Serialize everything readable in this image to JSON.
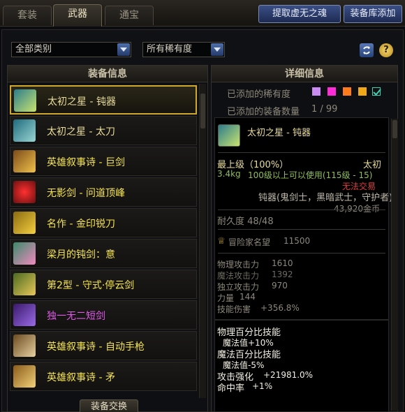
{
  "tabs": [
    {
      "label": "套装"
    },
    {
      "label": "武器"
    },
    {
      "label": "通宝"
    }
  ],
  "top_buttons": {
    "extract": "提取虚无之魂",
    "add": "装备库添加"
  },
  "filters": {
    "category": "全部类别",
    "rarity": "所有稀有度"
  },
  "left_panel": {
    "header": "装备信息",
    "items": [
      {
        "label": "太初之星 - 钝器",
        "color": "#e9dc9a"
      },
      {
        "label": "太初之星 - 太刀",
        "color": "#e9dc9a"
      },
      {
        "label": "英雄叙事诗 - 巨剑",
        "color": "#f5e44e"
      },
      {
        "label": "无影剑 - 问道顶峰",
        "color": "#f5e44e"
      },
      {
        "label": "名作 - 金印锐刀",
        "color": "#f5e44e"
      },
      {
        "label": "梁月的钝剑：意",
        "color": "#f5e44e"
      },
      {
        "label": "第2型 - 守式·停云剑",
        "color": "#f5e44e"
      },
      {
        "label": "独一无二短剑",
        "color": "#e05ae8"
      },
      {
        "label": "英雄叙事诗 - 自动手枪",
        "color": "#f5e44e"
      },
      {
        "label": "英雄叙事诗 - 矛",
        "color": "#f5e44e"
      }
    ],
    "swap_button": "装备交换"
  },
  "right_panel": {
    "header": "详细信息",
    "rarity_label": "已添加的稀有度",
    "count_label": "已添加的装备数量",
    "count_value": "1 / 99",
    "rarity_colors": [
      "#c98bf2",
      "#ff2bd8",
      "#ff7a1a",
      "#f0a818",
      "#37d3b5"
    ],
    "item": {
      "name": "太初之星 - 钝器",
      "grade": "最上级（100%）",
      "rarity": "太初",
      "weight": "3.4kg",
      "level_req": "100级以上可以使用(115级 - 15)",
      "trade": "无法交易",
      "type_line": "钝器(鬼剑士，黑暗武士，守护者)",
      "price": "43,920金币",
      "durability": "耐久度 48/48",
      "reputation": "冒险家名望",
      "reputation_value": "11500",
      "stats": [
        {
          "name": "物理攻击力",
          "value": "1610"
        },
        {
          "name": "魔法攻击力",
          "value": "1392"
        },
        {
          "name": "独立攻击力",
          "value": "970"
        },
        {
          "name": "力量",
          "value": "144"
        },
        {
          "name": "技能伤害",
          "value": "+356.8%"
        }
      ],
      "bonus": [
        {
          "text": "物理百分比技能",
          "indent": false
        },
        {
          "text": "魔法值+10%",
          "indent": true
        },
        {
          "text": "魔法百分比技能",
          "indent": false
        },
        {
          "text": "魔法值-5%",
          "indent": true
        },
        {
          "text": "攻击强化",
          "value": "+21981.0%",
          "indent": false
        },
        {
          "text": "命中率",
          "value": "+1%",
          "indent": false
        }
      ]
    }
  }
}
